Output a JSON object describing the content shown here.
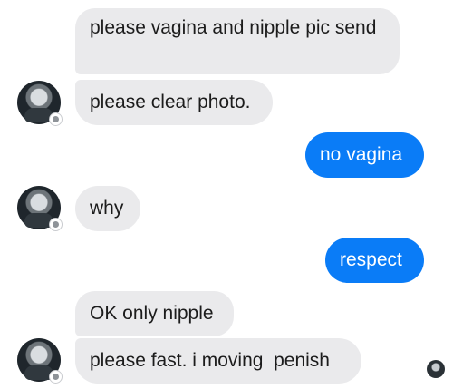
{
  "messages": [
    {
      "side": "in",
      "text": "please vagina and nipple pic send"
    },
    {
      "side": "in",
      "text": "please clear photo."
    },
    {
      "side": "out",
      "text": "no vagina"
    },
    {
      "side": "in",
      "text": "why"
    },
    {
      "side": "out",
      "text": "respect"
    },
    {
      "side": "in",
      "text": "OK only nipple"
    },
    {
      "side": "in",
      "text": "please fast. i moving  penish"
    }
  ],
  "icons": {
    "sender_avatar": "contact-avatar-icon",
    "badge": "facebook-badge-icon",
    "seen": "seen-avatar-icon"
  },
  "colors": {
    "incoming_bubble": "#eaeaec",
    "outgoing_bubble": "#0a7cf7"
  }
}
